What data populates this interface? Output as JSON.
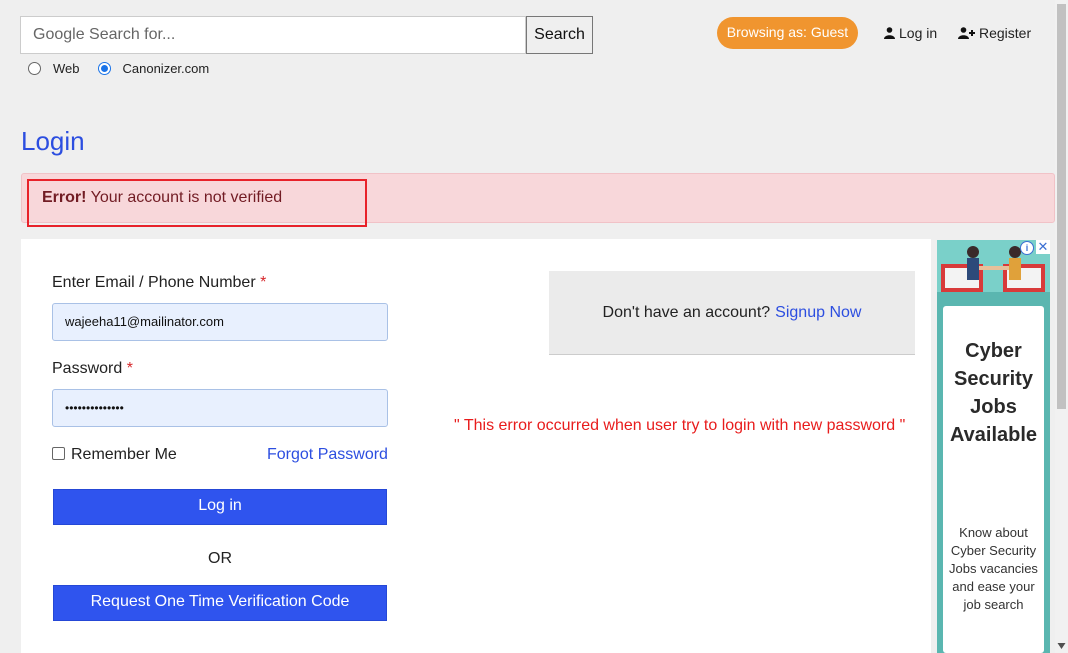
{
  "search": {
    "placeholder": "Google Search for...",
    "button_label": "Search",
    "options": [
      {
        "label": "Web",
        "selected": false
      },
      {
        "label": "Canonizer.com",
        "selected": true
      }
    ]
  },
  "header": {
    "guest_badge": "Browsing as: Guest",
    "login_label": "Log in",
    "register_label": "Register"
  },
  "page": {
    "title": "Login"
  },
  "alert": {
    "prefix": "Error!",
    "message": "Your account is not verified"
  },
  "form": {
    "email_label": "Enter Email / Phone Number",
    "required_mark": "*",
    "email_value": "wajeeha11@mailinator.com",
    "password_label": "Password",
    "password_value": "••••••••••••••",
    "remember_label": "Remember Me",
    "forgot_label": "Forgot Password",
    "login_button": "Log in",
    "or_text": "OR",
    "otp_button": "Request One Time Verification Code"
  },
  "signup": {
    "prompt": "Don't have an account?",
    "link": "Signup Now"
  },
  "note": "\" This error occurred when user try to login with new password \"",
  "ad": {
    "title": "Cyber Security Jobs Available",
    "description": "Know about Cyber Security Jobs vacancies and ease your job search",
    "info_glyph": "i",
    "close_glyph": "✕"
  },
  "colors": {
    "accent_blue": "#2f54ee",
    "guest_orange": "#f0952f",
    "error_bg": "#f8d7da",
    "error_text": "#721c24",
    "note_red": "#e81c1c"
  }
}
